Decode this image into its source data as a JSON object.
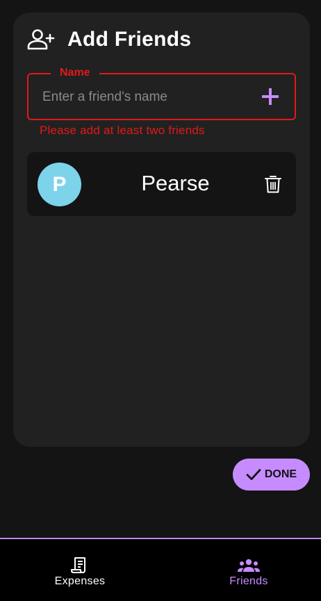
{
  "card": {
    "title": "Add Friends",
    "icon": "person-add-icon"
  },
  "name_field": {
    "label": "Name",
    "placeholder": "Enter a friend's name",
    "value": "",
    "add_icon": "plus-icon"
  },
  "error": {
    "message": "Please add at least two friends"
  },
  "friends": [
    {
      "initial": "P",
      "name": "Pearse",
      "avatar_color": "#7dd3ea",
      "delete_icon": "trash-icon"
    }
  ],
  "done_button": {
    "label": "DONE",
    "icon": "check-icon"
  },
  "bottom_nav": {
    "items": [
      {
        "label": "Expenses",
        "icon": "receipt-icon",
        "active": false
      },
      {
        "label": "Friends",
        "icon": "groups-icon",
        "active": true
      }
    ]
  },
  "colors": {
    "accent": "#c68cff",
    "error": "#e01a1a",
    "card_bg": "#212121",
    "page_bg": "#141414"
  }
}
